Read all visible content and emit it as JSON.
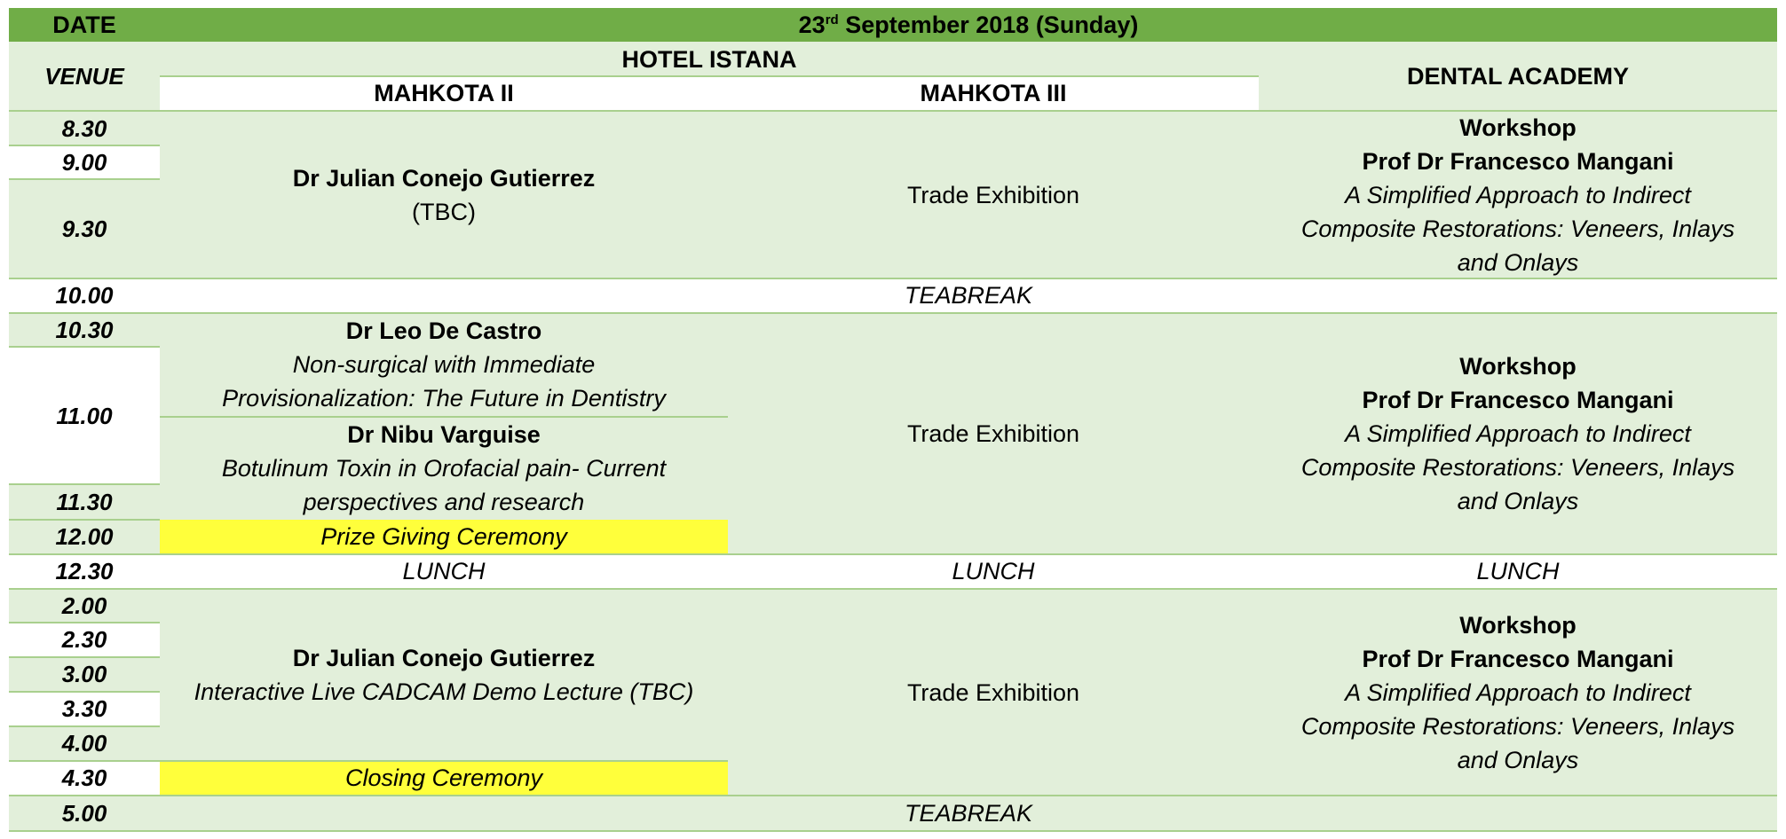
{
  "header": {
    "date_label": "DATE",
    "date_day": "23",
    "date_suffix": "rd",
    "date_rest": " September 2018 (Sunday)",
    "venue_label": "VENUE",
    "hotel": "HOTEL ISTANA",
    "room1": "MAHKOTA II",
    "room2": "MAHKOTA III",
    "academy": "DENTAL ACADEMY"
  },
  "times": [
    "8.30",
    "9.00",
    "9.30",
    "10.00",
    "10.30",
    "11.00",
    "11.30",
    "12.00",
    "12.30",
    "2.00",
    "2.30",
    "3.00",
    "3.30",
    "4.00",
    "4.30",
    "5.00"
  ],
  "morning": {
    "speaker": "Dr Julian Conejo Gutierrez",
    "note": "(TBC)"
  },
  "trade": "Trade Exhibition",
  "workshop": {
    "title": "Workshop",
    "speaker": "Prof Dr Francesco Mangani",
    "topic_l1": "A Simplified Approach to Indirect",
    "topic_l2": "Composite Restorations: Veneers, Inlays",
    "topic_l3": "and Onlays"
  },
  "teabreak": "TEABREAK",
  "lunch": "LUNCH",
  "talk1": {
    "speaker": "Dr Leo De Castro",
    "l1": "Non-surgical with Immediate",
    "l2": "Provisionalization: The Future in Dentistry"
  },
  "talk2": {
    "speaker": "Dr Nibu Varguise",
    "l1": "Botulinum Toxin in Orofacial pain- Current",
    "l2": "perspectives and research"
  },
  "prize": "Prize Giving Ceremony",
  "afternoon": {
    "speaker": "Dr Julian Conejo Gutierrez",
    "topic": "Interactive Live CADCAM Demo Lecture (TBC)"
  },
  "closing": "Closing Ceremony",
  "colors": {
    "header_green": "#70ad47",
    "light_green": "#e2efda",
    "highlight_yellow": "#ffff3b"
  }
}
